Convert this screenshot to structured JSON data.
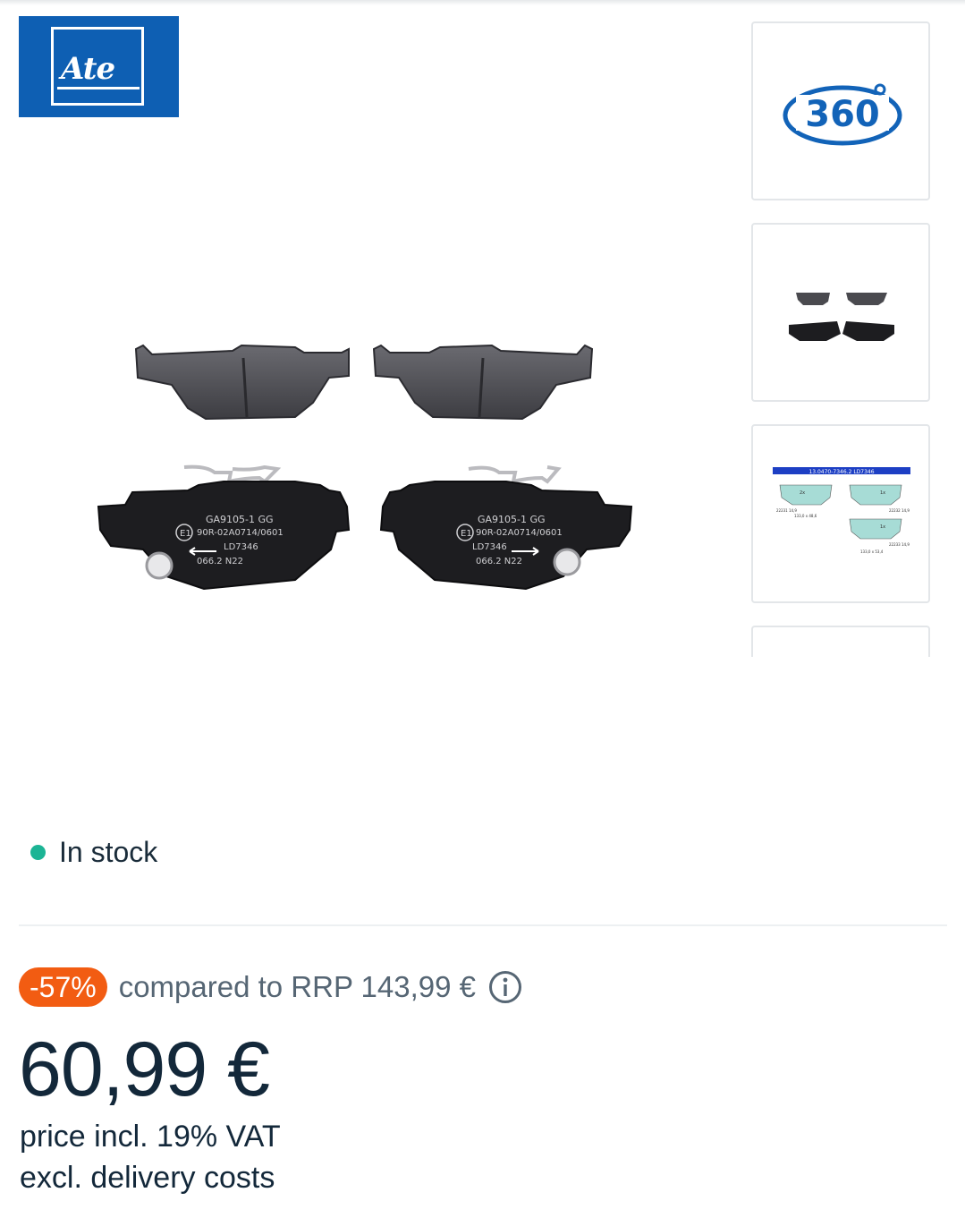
{
  "brand": {
    "logo_text": "Ate",
    "color": "#0e5fb3"
  },
  "gallery": {
    "main_image_alt": "brake pads",
    "thumbnails": [
      {
        "kind": "360-view",
        "label": "360"
      },
      {
        "kind": "product-photo",
        "label": ""
      },
      {
        "kind": "technical-drawing",
        "label": "13.0470-7346.2 LD7346"
      },
      {
        "kind": "partial",
        "label": ""
      }
    ],
    "pad_markings": {
      "line1": "GA9105-1 GG",
      "line2": "90R-02A0714/0601",
      "line3": "LD7346",
      "line4": "066.2",
      "line5": "N22",
      "approval_mark": "E1"
    },
    "drawing_labels": {
      "dim1": "22231 14,9",
      "dim2": "22232 14,9",
      "dim3": "22233 14,9",
      "size1": "133,0 x 48,6",
      "size2": "133,0 x 53,4",
      "qty1": "2x",
      "qty2": "1x",
      "qty3": "1x"
    }
  },
  "availability": {
    "text": "In stock",
    "color": "#1cb495"
  },
  "pricing": {
    "discount_badge": "-57%",
    "badge_color": "#f25c12",
    "rrp_text": "compared to RRP 143,99 €",
    "price": "60,99 €",
    "vat_note": "price incl. 19% VAT",
    "delivery_note": "excl. delivery costs"
  }
}
